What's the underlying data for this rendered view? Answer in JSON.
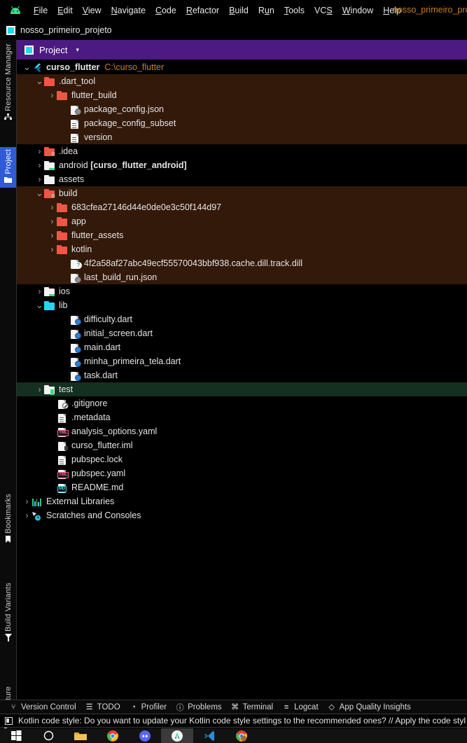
{
  "menu": {
    "logo_icon": "android-logo-icon",
    "items": [
      {
        "label": "File",
        "mnemonic": "F"
      },
      {
        "label": "Edit",
        "mnemonic": "E"
      },
      {
        "label": "View",
        "mnemonic": "V"
      },
      {
        "label": "Navigate",
        "mnemonic": "N"
      },
      {
        "label": "Code",
        "mnemonic": "C"
      },
      {
        "label": "Refactor",
        "mnemonic": "R"
      },
      {
        "label": "Build",
        "mnemonic": "B"
      },
      {
        "label": "Run",
        "mnemonic": "u"
      },
      {
        "label": "Tools",
        "mnemonic": "T"
      },
      {
        "label": "VCS",
        "mnemonic": "S"
      },
      {
        "label": "Window",
        "mnemonic": "W"
      },
      {
        "label": "Help",
        "mnemonic": "H"
      }
    ],
    "project_name": "nosso_primeiro_pro"
  },
  "breadcrumb": {
    "icon": "project-module-icon",
    "label": "nosso_primeiro_projeto"
  },
  "rail": {
    "items": [
      {
        "label": "Resource Manager",
        "icon": "resource-manager-icon",
        "active": false
      },
      {
        "label": "Project",
        "icon": "project-folder-icon",
        "active": true
      },
      {
        "label": "Bookmarks",
        "icon": "bookmark-icon",
        "active": false
      },
      {
        "label": "Build Variants",
        "icon": "build-variants-icon",
        "active": false
      },
      {
        "label": "Structure",
        "icon": "structure-icon",
        "active": false
      }
    ]
  },
  "panel": {
    "icon": "project-panel-icon",
    "title": "Project",
    "caret": "▾"
  },
  "tree": {
    "rows": [
      {
        "indent": 0,
        "arrow": "down",
        "icon": "flutter-project-icon",
        "label": "curso_flutter",
        "bold": true,
        "path": "C:\\curso_flutter",
        "bg": "none"
      },
      {
        "indent": 1,
        "arrow": "down",
        "icon": "folder-red-icon",
        "label": ".dart_tool",
        "bg": "brown"
      },
      {
        "indent": 2,
        "arrow": "right",
        "icon": "folder-red-icon",
        "label": "flutter_build",
        "bg": "brown"
      },
      {
        "indent": 3,
        "arrow": "none",
        "icon": "json-file-icon",
        "label": "package_config.json",
        "bg": "brown"
      },
      {
        "indent": 3,
        "arrow": "none",
        "icon": "text-file-icon",
        "label": "package_config_subset",
        "bg": "brown"
      },
      {
        "indent": 3,
        "arrow": "none",
        "icon": "text-file-icon",
        "label": "version",
        "bg": "brown"
      },
      {
        "indent": 1,
        "arrow": "right",
        "icon": "folder-idea-icon",
        "label": ".idea",
        "bg": "none"
      },
      {
        "indent": 1,
        "arrow": "right",
        "icon": "folder-android-icon",
        "label": "android ",
        "suffix": "[curso_flutter_android]",
        "bg": "none"
      },
      {
        "indent": 1,
        "arrow": "right",
        "icon": "folder-white-icon",
        "label": "assets",
        "bg": "none"
      },
      {
        "indent": 1,
        "arrow": "down",
        "icon": "folder-build-icon",
        "label": "build",
        "bg": "brown"
      },
      {
        "indent": 2,
        "arrow": "right",
        "icon": "folder-red-icon",
        "label": "683cfea27146d44e0de0e3c50f144d97",
        "bg": "brown"
      },
      {
        "indent": 2,
        "arrow": "right",
        "icon": "folder-red-icon",
        "label": "app",
        "bg": "brown"
      },
      {
        "indent": 2,
        "arrow": "right",
        "icon": "folder-red-icon",
        "label": "flutter_assets",
        "bg": "brown"
      },
      {
        "indent": 2,
        "arrow": "right",
        "icon": "folder-red-icon",
        "label": "kotlin",
        "bg": "brown"
      },
      {
        "indent": 3,
        "arrow": "none",
        "icon": "unknown-file-icon",
        "label": "4f2a58af27abc49ecf55570043bbf938.cache.dill.track.dill",
        "bg": "brown"
      },
      {
        "indent": 3,
        "arrow": "none",
        "icon": "json-file-icon",
        "label": "last_build_run.json",
        "bg": "brown"
      },
      {
        "indent": 1,
        "arrow": "right",
        "icon": "folder-android-icon",
        "label": "ios",
        "bg": "none"
      },
      {
        "indent": 1,
        "arrow": "down",
        "icon": "folder-cyan-icon",
        "label": "lib",
        "bg": "none"
      },
      {
        "indent": 3,
        "arrow": "none",
        "icon": "dart-file-icon",
        "label": "difficulty.dart",
        "bg": "none"
      },
      {
        "indent": 3,
        "arrow": "none",
        "icon": "dart-file-icon",
        "label": "initial_screen.dart",
        "bg": "none"
      },
      {
        "indent": 3,
        "arrow": "none",
        "icon": "dart-file-icon",
        "label": "main.dart",
        "bg": "none"
      },
      {
        "indent": 3,
        "arrow": "none",
        "icon": "dart-file-icon",
        "label": "minha_primeira_tela.dart",
        "bg": "none"
      },
      {
        "indent": 3,
        "arrow": "none",
        "icon": "dart-file-icon",
        "label": "task.dart",
        "bg": "none"
      },
      {
        "indent": 1,
        "arrow": "right",
        "icon": "folder-test-icon",
        "label": "test",
        "bg": "selected"
      },
      {
        "indent": 2,
        "arrow": "none",
        "icon": "gitignore-file-icon",
        "label": ".gitignore",
        "bg": "none"
      },
      {
        "indent": 2,
        "arrow": "none",
        "icon": "text-file-icon",
        "label": ".metadata",
        "bg": "none"
      },
      {
        "indent": 2,
        "arrow": "none",
        "icon": "yaml-file-icon",
        "label": "analysis_options.yaml",
        "bg": "none"
      },
      {
        "indent": 2,
        "arrow": "none",
        "icon": "iml-file-icon",
        "label": "curso_flutter.iml",
        "bg": "none"
      },
      {
        "indent": 2,
        "arrow": "none",
        "icon": "text-file-icon",
        "label": "pubspec.lock",
        "bg": "none"
      },
      {
        "indent": 2,
        "arrow": "none",
        "icon": "yaml-file-icon",
        "label": "pubspec.yaml",
        "bg": "none"
      },
      {
        "indent": 2,
        "arrow": "none",
        "icon": "markdown-file-icon",
        "label": "README.md",
        "bg": "none"
      },
      {
        "indent": 0,
        "arrow": "right",
        "icon": "external-libraries-icon",
        "label": "External Libraries",
        "bg": "none"
      },
      {
        "indent": 0,
        "arrow": "right",
        "icon": "scratches-icon",
        "label": "Scratches and Consoles",
        "bg": "none"
      }
    ]
  },
  "bottom_toolbar": {
    "items": [
      {
        "label": "Version Control",
        "icon": "branch-icon",
        "glyph": "⑂"
      },
      {
        "label": "TODO",
        "icon": "todo-list-icon",
        "glyph": "☰"
      },
      {
        "label": "Profiler",
        "icon": "profiler-gauge-icon",
        "glyph": "◔"
      },
      {
        "label": "Problems",
        "icon": "problems-warning-icon",
        "glyph": "ⓘ"
      },
      {
        "label": "Terminal",
        "icon": "terminal-icon",
        "glyph": "⌘"
      },
      {
        "label": "Logcat",
        "icon": "logcat-icon",
        "glyph": "≡"
      },
      {
        "label": "App Quality Insights",
        "icon": "diamond-icon",
        "glyph": "◇"
      }
    ]
  },
  "notification": {
    "icon": "copy-icon",
    "text": "Kotlin code style: Do you want to update your Kotlin code style settings to the recommended ones? // Apply the code styl"
  },
  "taskbar": {
    "apps": [
      {
        "name": "start-button-icon",
        "active": false
      },
      {
        "name": "search-icon",
        "active": false
      },
      {
        "name": "file-explorer-icon",
        "active": false
      },
      {
        "name": "chrome-icon",
        "active": false
      },
      {
        "name": "discord-icon",
        "active": false
      },
      {
        "name": "android-studio-icon",
        "active": true
      },
      {
        "name": "vscode-icon",
        "active": false
      },
      {
        "name": "chrome-profile-icon",
        "active": false
      }
    ]
  },
  "colors": {
    "accent_purple": "#4c1a82",
    "accent_blue": "#2f5bd8",
    "folder_red": "#f05545",
    "folder_cyan": "#24d7ee",
    "path_orange": "#c87e2b",
    "row_brown": "#33190a",
    "row_selected_green": "#143020"
  }
}
